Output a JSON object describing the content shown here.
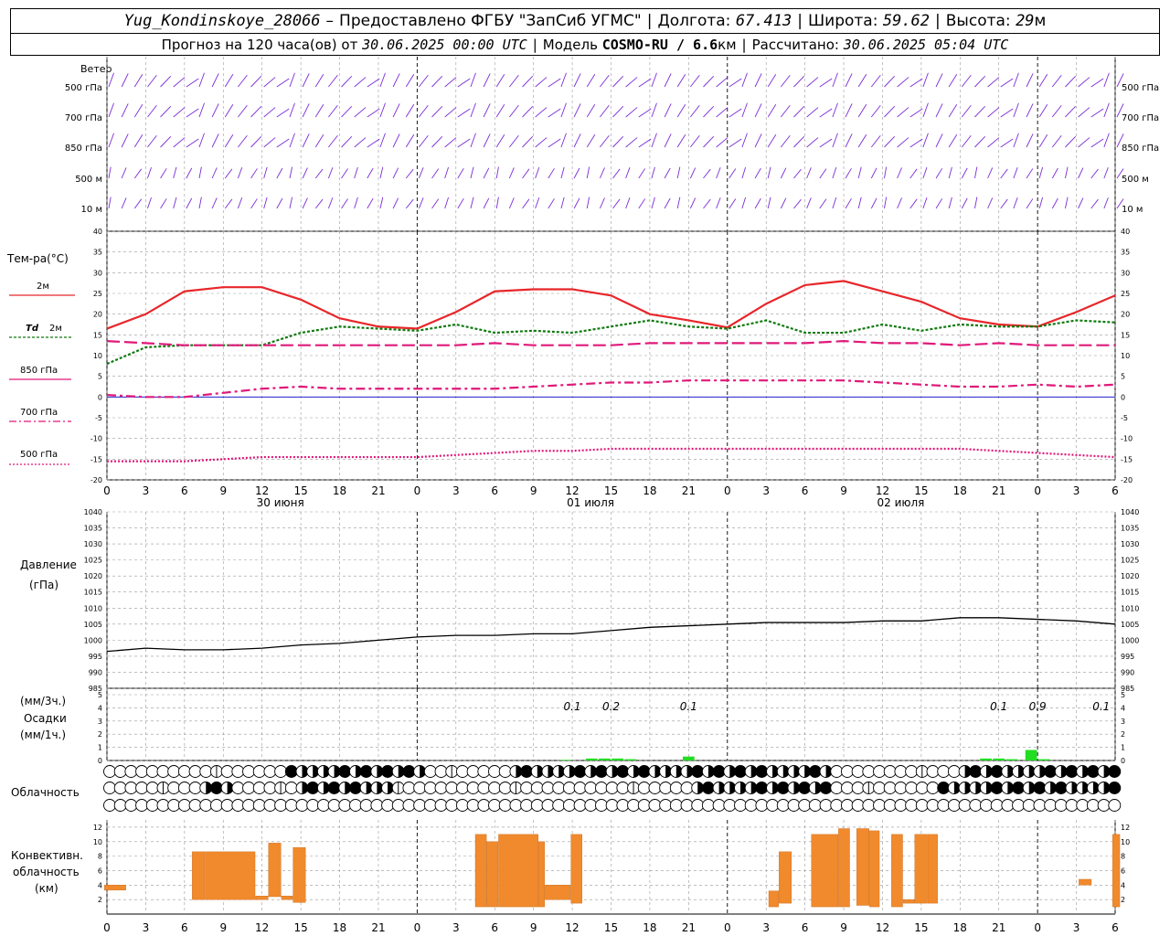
{
  "header": {
    "station": "Yug_Kondinskoye_28066",
    "dash": "–",
    "provider": "Предоставлено ФГБУ \"ЗапСиб УГМС\"",
    "lon_label": "Долгота:",
    "lon": "67.413",
    "lat_label": "Широта:",
    "lat": "59.62",
    "alt_label": "Высота:",
    "alt": "29",
    "alt_unit": "м",
    "forecast_prefix": "Прогноз на 120 часа(ов) от",
    "forecast_time": "30.06.2025 00:00 UTC",
    "model_label": "Модель",
    "model": "COSMO-RU / 6.6",
    "model_unit": "км",
    "computed_label": "Рассчитано:",
    "computed_time": "30.06.2025 05:04 UTC"
  },
  "panel_labels": {
    "wind": "Ветер",
    "temp_title": "Тем-ра(°C)",
    "legend_2m": "2м",
    "legend_td": "Td",
    "legend_td_unit": "2м",
    "legend_850": "850 гПа",
    "legend_700": "700 гПа",
    "legend_500": "500 гПа",
    "pressure_title": "Давление",
    "pressure_unit": "(гПа)",
    "precip_unit3": "(мм/3ч.)",
    "precip_title": "Осадки",
    "precip_unit1": "(мм/1ч.)",
    "cloud_title": "Облачность",
    "conv_title1": "Конвективн.",
    "conv_title2": "облачность",
    "conv_unit": "(км)"
  },
  "chart_data": [
    {
      "type": "wind_barbs",
      "levels": [
        "500 гПа",
        "700 гПа",
        "850 гПа",
        "500 м",
        "10 м"
      ]
    },
    {
      "type": "line",
      "x_hours": [
        0,
        3,
        6,
        9,
        12,
        15,
        18,
        21,
        24,
        27,
        30,
        33,
        36,
        39,
        42,
        45,
        48,
        51,
        54,
        57,
        60,
        63,
        66,
        69,
        72,
        75,
        78
      ],
      "x_tick_labels": [
        "0",
        "3",
        "6",
        "9",
        "12",
        "15",
        "18",
        "21",
        "0",
        "3",
        "6",
        "9",
        "12",
        "15",
        "18",
        "21",
        "0",
        "3",
        "6",
        "9",
        "12",
        "15",
        "18",
        "21",
        "0",
        "3",
        "6"
      ],
      "day_labels": [
        "30 июня",
        "01 июля",
        "02 июля"
      ],
      "ylim": [
        -20,
        40
      ],
      "y_ticks": [
        40,
        35,
        30,
        25,
        20,
        15,
        10,
        5,
        0,
        -5,
        -10,
        -15,
        -20
      ],
      "colors": {
        "t2m": "#e8262a",
        "td": "#0f7a0f",
        "p850": "#e0187a",
        "p700": "#e0187a",
        "p500": "#e0187a",
        "zero": "#0000cc"
      },
      "series": [
        {
          "name": "2м",
          "values": [
            16.5,
            20,
            25.5,
            26.5,
            26.5,
            23.5,
            19,
            17,
            16.5,
            20.5,
            25.5,
            26,
            26,
            24.5,
            20,
            18.5,
            16.8,
            22.5,
            27,
            28,
            25.5,
            23,
            19,
            17.5,
            17,
            20.5,
            24.5
          ]
        },
        {
          "name": "Td 2м",
          "values": [
            8,
            12,
            12.5,
            12.5,
            12.5,
            15.5,
            17,
            16.5,
            16,
            17.5,
            15.5,
            16,
            15.5,
            17,
            18.5,
            17,
            16.5,
            18.5,
            15.5,
            15.5,
            17.5,
            16,
            17.5,
            17,
            17,
            18.5,
            18
          ]
        },
        {
          "name": "850 гПа",
          "values": [
            13.5,
            13,
            12.5,
            12.5,
            12.5,
            12.5,
            12.5,
            12.5,
            12.5,
            12.5,
            13,
            12.5,
            12.5,
            12.5,
            13,
            13,
            13,
            13,
            13,
            13.5,
            13,
            13,
            12.5,
            13,
            12.5,
            12.5,
            12.5
          ]
        },
        {
          "name": "700 гПа",
          "values": [
            0.5,
            0,
            0,
            1,
            2,
            2.5,
            2,
            2,
            2,
            2,
            2,
            2.5,
            3,
            3.5,
            3.5,
            4,
            4,
            4,
            4,
            4,
            3.5,
            3,
            2.5,
            2.5,
            3,
            2.5,
            3
          ]
        },
        {
          "name": "500 гПа",
          "values": [
            -15.5,
            -15.5,
            -15.5,
            -15,
            -14.5,
            -14.5,
            -14.5,
            -14.5,
            -14.5,
            -14,
            -13.5,
            -13,
            -13,
            -12.5,
            -12.5,
            -12.5,
            -12.5,
            -12.5,
            -12.5,
            -12.5,
            -12.5,
            -12.5,
            -12.5,
            -13,
            -13.5,
            -14,
            -14.5
          ]
        }
      ]
    },
    {
      "type": "line",
      "ylim": [
        985,
        1040
      ],
      "y_ticks": [
        1040,
        1035,
        1030,
        1025,
        1020,
        1015,
        1010,
        1005,
        1000,
        995,
        990,
        985
      ],
      "series": [
        {
          "name": "Давление",
          "values": [
            996.5,
            997.5,
            997,
            997,
            997.5,
            998.5,
            999,
            1000,
            1001,
            1001.5,
            1001.5,
            1002,
            1002,
            1003,
            1004,
            1004.5,
            1005,
            1005.5,
            1005.5,
            1005.5,
            1006,
            1006,
            1007,
            1007,
            1006.5,
            1006,
            1005
          ]
        }
      ]
    },
    {
      "type": "bar",
      "ylim": [
        0,
        5
      ],
      "y_ticks": [
        5,
        4,
        3,
        2,
        1,
        0
      ],
      "sums_3h": [
        {
          "x": 36,
          "label": "0.1"
        },
        {
          "x": 39,
          "label": "0.2"
        },
        {
          "x": 45,
          "label": "0.1"
        },
        {
          "x": 69,
          "label": "0.1"
        },
        {
          "x": 72,
          "label": "0.9"
        },
        {
          "x": 93,
          "label": "0.1"
        }
      ],
      "hourly": [
        {
          "x": 35.5,
          "value": 0.05
        },
        {
          "x": 37.5,
          "value": 0.15
        },
        {
          "x": 38.5,
          "value": 0.15
        },
        {
          "x": 39.5,
          "value": 0.15
        },
        {
          "x": 40.5,
          "value": 0.1
        },
        {
          "x": 45,
          "value": 0.3
        },
        {
          "x": 68,
          "value": 0.15
        },
        {
          "x": 69,
          "value": 0.15
        },
        {
          "x": 70,
          "value": 0.1
        },
        {
          "x": 71.5,
          "value": 0.8
        },
        {
          "x": 72.5,
          "value": 0.1
        },
        {
          "x": 92.5,
          "value": 0.25
        }
      ]
    },
    {
      "type": "cloud_symbols",
      "rows": 3,
      "cols": 95
    },
    {
      "type": "bar",
      "ylim": [
        0,
        13
      ],
      "y_ticks": [
        12,
        10,
        8,
        6,
        4,
        2
      ],
      "bars": [
        {
          "x0": -0.2,
          "x1": 1.5,
          "base": 3.3,
          "top": 4.0
        },
        {
          "x0": 6.6,
          "x1": 7.6,
          "base": 2.0,
          "top": 8.6
        },
        {
          "x0": 7.6,
          "x1": 11.5,
          "base": 2.0,
          "top": 8.6
        },
        {
          "x0": 11.5,
          "x1": 12.5,
          "base": 2.0,
          "top": 2.5
        },
        {
          "x0": 12.5,
          "x1": 13.5,
          "base": 2.4,
          "top": 9.8
        },
        {
          "x0": 13.5,
          "x1": 14.4,
          "base": 2.0,
          "top": 2.5
        },
        {
          "x0": 14.4,
          "x1": 15.4,
          "base": 1.6,
          "top": 9.2
        },
        {
          "x0": 28.5,
          "x1": 29.4,
          "base": 1.0,
          "top": 11.0
        },
        {
          "x0": 29.4,
          "x1": 30.3,
          "base": 1.0,
          "top": 10.0
        },
        {
          "x0": 30.3,
          "x1": 33.4,
          "base": 1.0,
          "top": 11.0
        },
        {
          "x0": 33.4,
          "x1": 33.9,
          "base": 1.0,
          "top": 10.0
        },
        {
          "x0": 33.9,
          "x1": 35.9,
          "base": 2.0,
          "top": 4.0
        },
        {
          "x0": 35.9,
          "x1": 36.8,
          "base": 1.5,
          "top": 11.0
        },
        {
          "x0": 51.2,
          "x1": 52.0,
          "base": 1.0,
          "top": 3.2
        },
        {
          "x0": 52.0,
          "x1": 53.0,
          "base": 1.5,
          "top": 8.6
        },
        {
          "x0": 54.5,
          "x1": 56.6,
          "base": 1.0,
          "top": 11.0
        },
        {
          "x0": 56.6,
          "x1": 57.5,
          "base": 1.0,
          "top": 11.8
        },
        {
          "x0": 58.0,
          "x1": 59.0,
          "base": 1.2,
          "top": 11.8
        },
        {
          "x0": 59.0,
          "x1": 59.8,
          "base": 1.0,
          "top": 11.5
        },
        {
          "x0": 60.7,
          "x1": 61.6,
          "base": 1.0,
          "top": 11.0
        },
        {
          "x0": 61.6,
          "x1": 62.5,
          "base": 1.5,
          "top": 2.0
        },
        {
          "x0": 62.5,
          "x1": 63.5,
          "base": 1.5,
          "top": 11.0
        },
        {
          "x0": 63.5,
          "x1": 64.3,
          "base": 1.5,
          "top": 11.0
        },
        {
          "x0": 75.2,
          "x1": 76.2,
          "base": 4.0,
          "top": 4.8
        },
        {
          "x0": 77.8,
          "x1": 78.4,
          "base": 1.0,
          "top": 11.0
        }
      ]
    }
  ]
}
